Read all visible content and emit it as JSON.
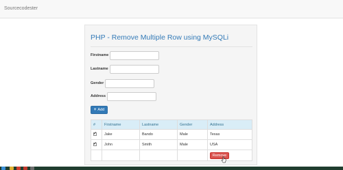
{
  "navbar": {
    "brand": "Sourcecodester"
  },
  "panel": {
    "title": "PHP - Remove Multiple Row using MySQLi"
  },
  "form": {
    "firstname_label": "Firstname",
    "lastname_label": "Lastname",
    "gender_label": "Gender",
    "address_label": "Address",
    "firstname_value": "",
    "lastname_value": "",
    "gender_value": "",
    "address_value": "",
    "add_label": "Add",
    "add_icon": "plus-icon"
  },
  "table": {
    "headers": [
      "#",
      "Firstname",
      "Lastname",
      "Gender",
      "Address"
    ],
    "rows": [
      {
        "checked": true,
        "firstname": "Jake",
        "lastname": "Bando",
        "gender": "Male",
        "address": "Texas"
      },
      {
        "checked": true,
        "firstname": "John",
        "lastname": "Smith",
        "gender": "Male",
        "address": "USA"
      }
    ],
    "remove_label": "Remove"
  },
  "colors": {
    "primary": "#337ab7",
    "danger": "#d9534f",
    "table_header": "#d9edf7",
    "taskbar": "#1f3d2e"
  }
}
